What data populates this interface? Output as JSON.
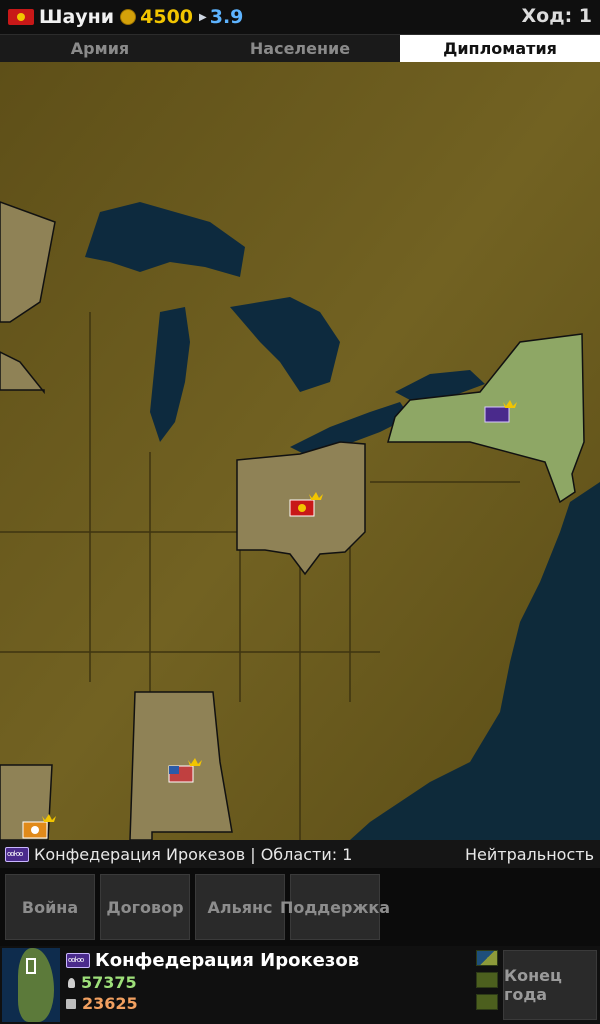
{
  "top_bar": {
    "country": "Шауни",
    "gold": "4500",
    "income": "3.9",
    "turn": "Ход: 1"
  },
  "tabs": [
    {
      "label": "Армия",
      "active": false
    },
    {
      "label": "Население",
      "active": false
    },
    {
      "label": "Дипломатия",
      "active": true
    }
  ],
  "info_strip": {
    "nation": "Конфедерация Ирокезов | Области: 1",
    "status": "Нейтральность"
  },
  "actions": {
    "war": "Война",
    "treaty": "Договор",
    "alliance": "Альянс",
    "support": "Поддержка"
  },
  "bottom_bar": {
    "nation_name": "Конфедерация Ирокезов",
    "population": "57375",
    "soldiers": "23625",
    "end_turn": "Конец года"
  },
  "colors": {
    "gold": "#f2c500",
    "income": "#5eb4ff",
    "population": "#9ee07a",
    "soldiers": "#f2a060",
    "land": "#6b5a1f",
    "water": "#0d2a3e"
  },
  "icons": [
    "shawnee-flag-icon",
    "coin-icon",
    "arrow-icon",
    "iroquois-flag-icon",
    "population-icon",
    "soldier-icon",
    "map-mode-icon",
    "eye-icon"
  ]
}
